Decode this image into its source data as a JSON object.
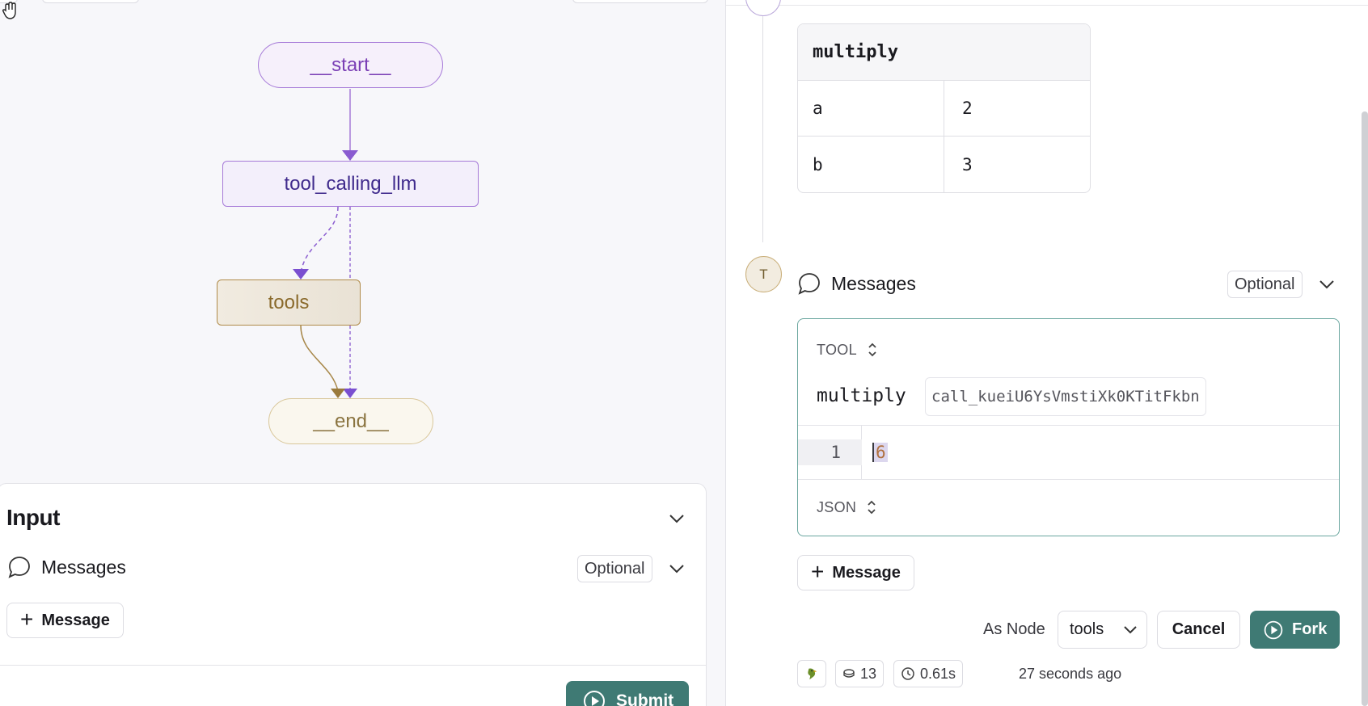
{
  "graph": {
    "nodes": {
      "start": "__start__",
      "tool_calling_llm": "tool_calling_llm",
      "tools": "tools",
      "end": "__end__"
    }
  },
  "input_panel": {
    "title": "Input",
    "messages_label": "Messages",
    "optional_label": "Optional",
    "add_message_label": "Message",
    "submit_label": "Submit"
  },
  "tool_call": {
    "name": "multiply",
    "args": [
      {
        "key": "a",
        "value": "2"
      },
      {
        "key": "b",
        "value": "3"
      }
    ]
  },
  "tool_message": {
    "avatar_letter": "T",
    "section_label": "Messages",
    "optional_label": "Optional",
    "role": "TOOL",
    "tool_name": "multiply",
    "tool_call_id": "call_kueiU6YsVmstiXk0KTitFkbn",
    "line_number": "1",
    "content": "6",
    "format": "JSON"
  },
  "actions": {
    "add_message_label": "Message",
    "as_node_label": "As Node",
    "as_node_value": "tools",
    "cancel_label": "Cancel",
    "fork_label": "Fork"
  },
  "run_meta": {
    "tokens": "13",
    "latency": "0.61s",
    "time_ago": "27 seconds ago"
  },
  "colors": {
    "accent_teal": "#3f7a74",
    "graph_purple": "#a67ad8",
    "graph_gold": "#b08b4a"
  }
}
